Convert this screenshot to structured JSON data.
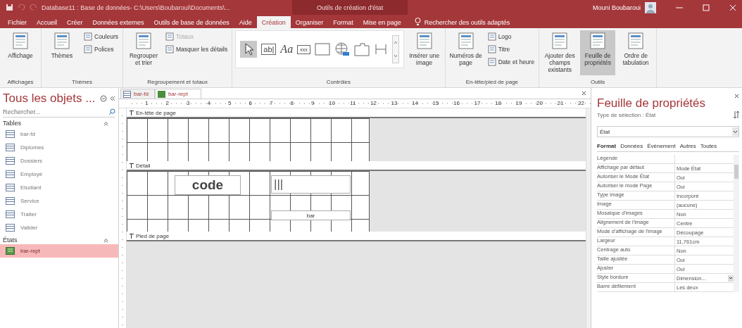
{
  "window": {
    "title": "Database11 : Base de données- C:\\Users\\Boubaroui\\Documents\\...",
    "context_title": "Outils de création d'état",
    "user": "Mouni Boubaroui"
  },
  "menu_tabs": [
    {
      "label": "Fichier",
      "selected": false
    },
    {
      "label": "Accueil",
      "selected": false
    },
    {
      "label": "Créer",
      "selected": false
    },
    {
      "label": "Données externes",
      "selected": false
    },
    {
      "label": "Outils de base de données",
      "selected": false
    },
    {
      "label": "Aide",
      "selected": false
    },
    {
      "label": "Création",
      "selected": true
    },
    {
      "label": "Organiser",
      "selected": false
    },
    {
      "label": "Format",
      "selected": false
    },
    {
      "label": "Mise en page",
      "selected": false
    }
  ],
  "tell_me": "Rechercher des outils adaptés",
  "ribbon": [
    {
      "label": "Affichages",
      "buttons": [
        {
          "label": "Affichage",
          "kind": "large",
          "selected": false,
          "disabled": false
        }
      ]
    },
    {
      "label": "Thèmes",
      "buttons": [
        {
          "label": "Thèmes",
          "kind": "large",
          "selected": false,
          "disabled": false
        },
        {
          "label": "Couleurs",
          "kind": "small",
          "selected": false,
          "disabled": false
        },
        {
          "label": "Polices",
          "kind": "small",
          "selected": false,
          "disabled": false
        }
      ]
    },
    {
      "label": "Regroupement et totaux",
      "buttons": [
        {
          "label": "Regrouper et trier",
          "kind": "large",
          "selected": false,
          "disabled": false
        },
        {
          "label": "Totaux",
          "kind": "small",
          "selected": false,
          "disabled": true
        },
        {
          "label": "Masquer les détails",
          "kind": "small",
          "selected": false,
          "disabled": false
        }
      ]
    },
    {
      "label": "Contrôles",
      "gallery": [
        "ab|",
        "Aa",
        "xxx"
      ],
      "buttons": [
        {
          "label": "Insérer une image",
          "kind": "large",
          "selected": false,
          "disabled": false
        }
      ]
    },
    {
      "label": "En-tête/pied de page",
      "buttons": [
        {
          "label": "Numéros de page",
          "kind": "large",
          "selected": false,
          "disabled": false
        },
        {
          "label": "Logo",
          "kind": "small",
          "selected": false,
          "disabled": false
        },
        {
          "label": "Titre",
          "kind": "small",
          "selected": false,
          "disabled": false
        },
        {
          "label": "Date et heure",
          "kind": "small",
          "selected": false,
          "disabled": false
        }
      ]
    },
    {
      "label": "Outils",
      "buttons": [
        {
          "label": "Ajouter des champs existants",
          "kind": "large",
          "selected": false,
          "disabled": false
        },
        {
          "label": "Feuille de propriétés",
          "kind": "large",
          "selected": true,
          "disabled": false
        },
        {
          "label": "Ordre de tabulation",
          "kind": "large",
          "selected": false,
          "disabled": false
        }
      ]
    }
  ],
  "nav": {
    "title": "Tous les objets ...",
    "search": {
      "placeholder": "Rechercher..."
    },
    "groups": [
      {
        "label": "Tables",
        "kind": "table",
        "items": [
          {
            "label": "bar-fd",
            "selected": false
          },
          {
            "label": "Diplomes",
            "selected": false
          },
          {
            "label": "Dossiers",
            "selected": false
          },
          {
            "label": "Employé",
            "selected": false
          },
          {
            "label": "Etudiant",
            "selected": false
          },
          {
            "label": "Service",
            "selected": false
          },
          {
            "label": "Traiter",
            "selected": false
          },
          {
            "label": "Valider",
            "selected": false
          }
        ]
      },
      {
        "label": "États",
        "kind": "report",
        "items": [
          {
            "label": "bar-rept",
            "selected": true
          }
        ]
      }
    ]
  },
  "doc_tabs": [
    {
      "label": "bar-fd",
      "kind": "table",
      "selected": false
    },
    {
      "label": "bar-rept",
      "kind": "report",
      "selected": true
    }
  ],
  "ruler_marks": [
    "1",
    "2",
    "3",
    "4",
    "5",
    "6",
    "7",
    "8",
    "9",
    "10",
    "11",
    "12",
    "13",
    "14",
    "15",
    "16",
    "17",
    "18",
    "19",
    "20",
    "21",
    "22"
  ],
  "sections": [
    {
      "title": "En-tête de page",
      "kind": "header"
    },
    {
      "title": "Détail",
      "kind": "detail",
      "controls": [
        {
          "kind": "label",
          "text": "code"
        },
        {
          "kind": "textbox",
          "text": "|||"
        },
        {
          "kind": "caption",
          "text": "bar"
        }
      ]
    },
    {
      "title": "Pied de page",
      "kind": "footer"
    }
  ],
  "properties": {
    "title": "Feuille de propriétés",
    "selection_type": "Type de sélection : État",
    "object": "État",
    "tabs": [
      {
        "label": "Format",
        "selected": true
      },
      {
        "label": "Données",
        "selected": false
      },
      {
        "label": "Événement",
        "selected": false
      },
      {
        "label": "Autres",
        "selected": false
      },
      {
        "label": "Toutes",
        "selected": false
      }
    ],
    "rows": [
      {
        "name": "Légende"
      },
      {
        "name": "Affichage par défaut",
        "value": "Mode État"
      },
      {
        "name": "Autoriser le Mode État",
        "value": "Oui"
      },
      {
        "name": "Autoriser le mode Page",
        "value": "Oui"
      },
      {
        "name": "Type image",
        "value": "Incorporé"
      },
      {
        "name": "Image",
        "value": "(aucune)"
      },
      {
        "name": "Mosaïque d'images",
        "value": "Non"
      },
      {
        "name": "Alignement de l'image",
        "value": "Centre"
      },
      {
        "name": "Mode d'affichage de l'image",
        "value": "Découpage"
      },
      {
        "name": "Largeur",
        "value": "11,761cm"
      },
      {
        "name": "Centrage auto",
        "value": "Non"
      },
      {
        "name": "Taille ajustée",
        "value": "Oui"
      },
      {
        "name": "Ajuster",
        "value": "Oui"
      },
      {
        "name": "Style bordure",
        "value": "Dimension...",
        "kind": "dropdown"
      },
      {
        "name": "Barre défilement",
        "value": "Les deux"
      }
    ]
  }
}
